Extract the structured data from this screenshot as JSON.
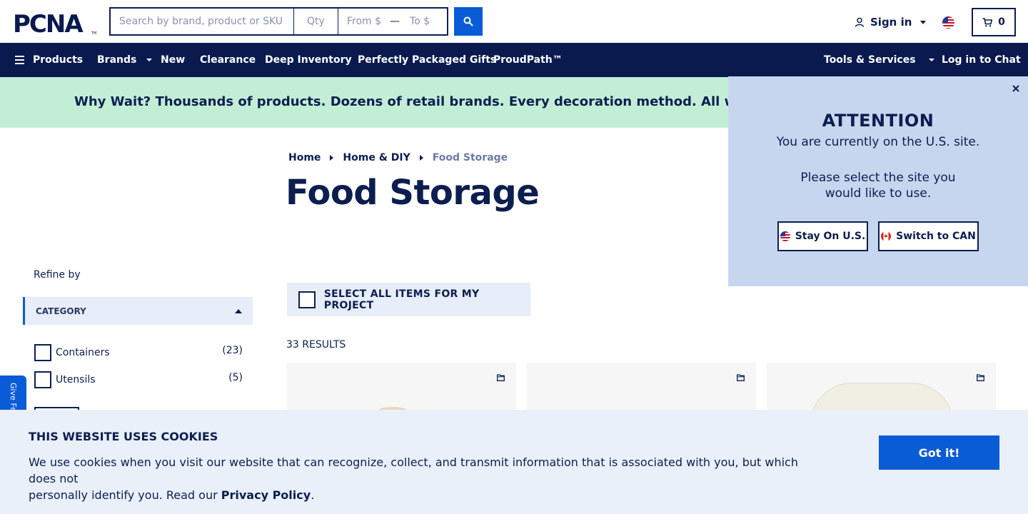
{
  "header": {
    "logo_text": "PCNA",
    "search_placeholder": "Search by brand, product or SKU",
    "qty_placeholder": "Qty",
    "price_from_placeholder": "From $",
    "price_to_placeholder": "To $",
    "sign_in_label": "Sign in",
    "cart_count": "0"
  },
  "nav": {
    "items": [
      {
        "label": "Products"
      },
      {
        "label": "Brands"
      },
      {
        "label": "New"
      },
      {
        "label": "Clearance"
      },
      {
        "label": "Deep Inventory"
      },
      {
        "label": "Perfectly Packaged Gifts"
      },
      {
        "label": "ProudPath™"
      }
    ],
    "tools_label": "Tools & Services",
    "chat_label": "Log in to Chat"
  },
  "banner": {
    "text": "Why Wait? Thousands of products. Dozens of retail brands. Every decoration method. All with a standard"
  },
  "breadcrumb": {
    "items": [
      "Home",
      "Home & DIY"
    ],
    "current": "Food Storage"
  },
  "page_title": "Food Storage",
  "sidebar": {
    "refine_label": "Refine by",
    "category_header": "CATEGORY",
    "categories": [
      {
        "label": "Containers",
        "count": "(23)"
      },
      {
        "label": "Utensils",
        "count": "(5)"
      }
    ],
    "feedback_label": "Give Feedback"
  },
  "results": {
    "select_all_label": "SELECT ALL ITEMS FOR MY PROJECT",
    "count_label": "33 RESULTS"
  },
  "popup": {
    "title": "ATTENTION",
    "line1": "You are currently on the U.S. site.",
    "line2": "Please select the site you",
    "line3": "would like to use.",
    "stay_label": "Stay On U.S.",
    "switch_label": "Switch to CAN"
  },
  "cookie": {
    "title": "THIS WEBSITE USES COOKIES",
    "text_line1": "We use cookies when you visit our website that can recognize, collect, and transmit information that is associated with you, but which does not",
    "text_line2_prefix": "personally identify you. Read our ",
    "privacy_link": "Privacy Policy",
    "text_suffix": ".",
    "button_label": "Got it!"
  },
  "colors": {
    "navy": "#0a1a4f",
    "brand_blue": "#0a5bd6",
    "banner_green": "#c3eed6",
    "popup_bg": "#c7d6ef",
    "cookie_bg": "#eaf0fa"
  }
}
